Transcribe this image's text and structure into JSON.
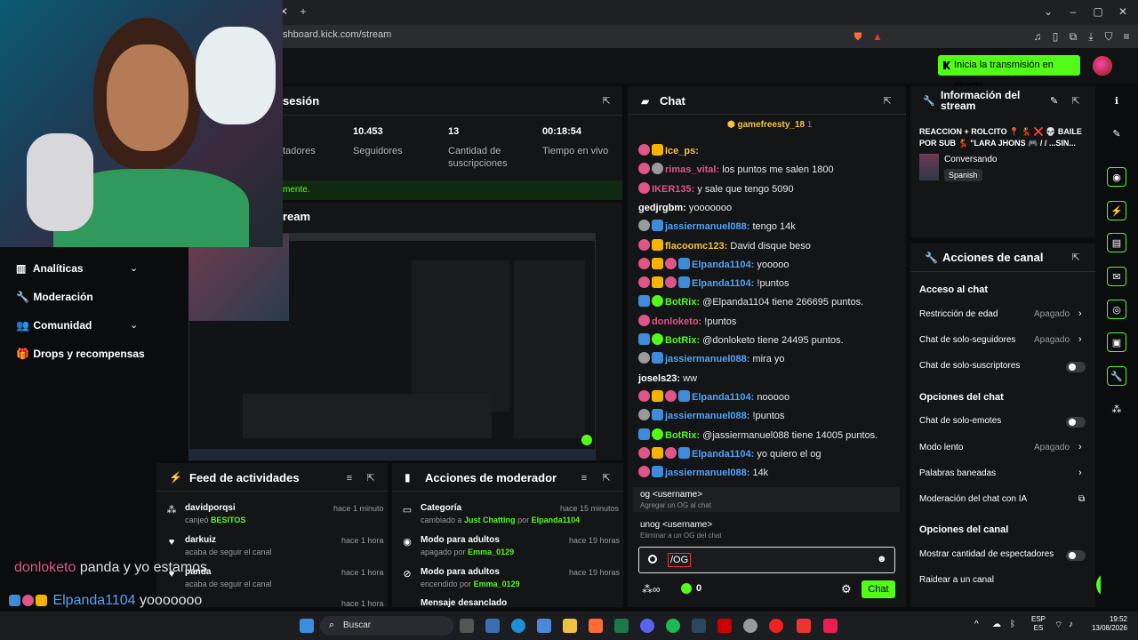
{
  "browser": {
    "url": "shboard.kick.com/stream",
    "new_tab": "+"
  },
  "header": {
    "go_live": "Inicia la transmisión en directo"
  },
  "session": {
    "title_partial": "sesión",
    "stats": [
      {
        "value": "",
        "label": "tadores"
      },
      {
        "value": "10.453",
        "label": "Seguidores"
      },
      {
        "value": "13",
        "label": "Cantidad de suscripciones"
      },
      {
        "value": "00:18:54",
        "label": "Tiempo en vivo"
      }
    ],
    "note_partial": "mente."
  },
  "stream_section_partial": "ream",
  "sidebar": {
    "items": [
      {
        "label": "Analíticas",
        "has_chevron": true
      },
      {
        "label": "Moderación",
        "has_chevron": false
      },
      {
        "label": "Comunidad",
        "has_chevron": true
      },
      {
        "label": "Drops y recompensas",
        "has_chevron": false
      }
    ]
  },
  "chat": {
    "title": "Chat",
    "pinned_user": "gamefreesty_18",
    "pinned_count": "1",
    "messages": [
      {
        "user": "Ice_ps:",
        "text": "",
        "color": "#f5c242"
      },
      {
        "user": "rimas_vital:",
        "text": "los puntos me salen 1800",
        "color": "#e05587"
      },
      {
        "user": "IKER135:",
        "text": "y sale que tengo 5090",
        "color": "#e05587"
      },
      {
        "user": "gedjrgbm:",
        "text": "yooooooo",
        "color": "#ffffff"
      },
      {
        "user": "jassiermanuel088:",
        "text": "tengo 14k",
        "color": "#4fa3f7"
      },
      {
        "user": "flacoomc123:",
        "text": "David disque beso",
        "color": "#f5c242"
      },
      {
        "user": "Elpanda1104:",
        "text": "yooooo",
        "color": "#4fa3f7"
      },
      {
        "user": "Elpanda1104:",
        "text": "!puntos",
        "color": "#4fa3f7"
      },
      {
        "user": "BotRix:",
        "text": "@Elpanda1104 tiene 266695 puntos.",
        "color": "#53fc18"
      },
      {
        "user": "donloketo:",
        "text": "!puntos",
        "color": "#e05587"
      },
      {
        "user": "BotRix:",
        "text": "@donloketo tiene 24495 puntos.",
        "color": "#53fc18"
      },
      {
        "user": "jassiermanuel088:",
        "text": "mira yo",
        "color": "#4fa3f7"
      },
      {
        "user": "josels23:",
        "text": "ww",
        "color": "#ffffff"
      },
      {
        "user": "Elpanda1104:",
        "text": "nooooo",
        "color": "#4fa3f7"
      },
      {
        "user": "jassiermanuel088:",
        "text": "!puntos",
        "color": "#4fa3f7"
      },
      {
        "user": "BotRix:",
        "text": "@jassiermanuel088 tiene 14005 puntos.",
        "color": "#53fc18"
      },
      {
        "user": "Elpanda1104:",
        "text": "yo quiero el og",
        "color": "#4fa3f7"
      },
      {
        "user": "jassiermanuel088:",
        "text": "14k",
        "color": "#4fa3f7"
      }
    ],
    "commands": [
      {
        "cmd": "og <username>",
        "desc": "Agregar un OG al chat"
      },
      {
        "cmd": "unog <username>",
        "desc": "Eliminar a un OG del chat"
      }
    ],
    "input_value": "/OG",
    "viewers": "0",
    "send_label": "Chat"
  },
  "stream_info": {
    "title": "Información del stream",
    "stream_title": "REACCION + ROLCITO 📍 💃 ❌ 💀 BAILE POR SUB 💃 \"LARA JHONS 🎮 / / ...SIN...",
    "category": "Conversando",
    "language": "Spanish"
  },
  "channel_actions": {
    "title": "Acciones de canal",
    "section_chat": "Acceso al chat",
    "rows_access": [
      {
        "label": "Restricción de edad",
        "value": "Apagado",
        "control": "chevron"
      },
      {
        "label": "Chat de solo-seguidores",
        "value": "Apagado",
        "control": "chevron"
      },
      {
        "label": "Chat de solo-suscriptores",
        "value": "",
        "control": "toggle"
      }
    ],
    "section_options": "Opciones del chat",
    "rows_options": [
      {
        "label": "Chat de solo-emotes",
        "value": "",
        "control": "toggle"
      },
      {
        "label": "Modo lento",
        "value": "Apagado",
        "control": "chevron"
      },
      {
        "label": "Palabras baneadas",
        "value": "",
        "control": "chevron"
      },
      {
        "label": "Moderación del chat con IA",
        "value": "",
        "control": "external"
      }
    ],
    "section_channel": "Opciones del canal",
    "rows_channel": [
      {
        "label": "Mostrar cantidad de espectadores",
        "value": "",
        "control": "toggle"
      },
      {
        "label": "Raidear a un canal",
        "value": "",
        "control": "none"
      }
    ]
  },
  "activity_feed": {
    "title": "Feed de actividades",
    "items": [
      {
        "name": "davidporqsi",
        "action": "canjeó",
        "extra": "BESITOS",
        "time": "hace 1 minuto"
      },
      {
        "name": "darkuiz",
        "action": "acaba de seguir el canal",
        "extra": "",
        "time": "hace 1 hora"
      },
      {
        "name": "panda",
        "action": "acaba de seguir el canal",
        "extra": "",
        "time": "hace 1 hora"
      },
      {
        "name": "",
        "action": "",
        "extra": "",
        "time": "hace 1 hora"
      }
    ]
  },
  "mod_actions": {
    "title": "Acciones de moderador",
    "items": [
      {
        "name": "Categoría",
        "desc_pre": "cambiado a",
        "desc_hl": "Just Chatting",
        "desc_mid": "por",
        "desc_user": "Elpanda1104",
        "time": "hace 15 minutos"
      },
      {
        "name": "Modo para adultos",
        "desc_pre": "apagado por",
        "desc_hl": "",
        "desc_mid": "",
        "desc_user": "Emma_0129",
        "time": "hace 19 horas"
      },
      {
        "name": "Modo para adultos",
        "desc_pre": "encendido por",
        "desc_hl": "",
        "desc_mid": "",
        "desc_user": "Emma_0129",
        "time": "hace 19 horas"
      },
      {
        "name": "Mensaje desanclado",
        "desc_pre": "",
        "desc_hl": "",
        "desc_mid": "",
        "desc_user": "",
        "time": ""
      }
    ]
  },
  "overlay": {
    "line1_user": "donloketo",
    "line1_text": "panda y yo estamos",
    "line2_user": "Elpanda1104",
    "line2_text": "yooooooo"
  },
  "taskbar": {
    "search": "Buscar",
    "lang1": "ESP",
    "lang2": "ES",
    "time": "19:52",
    "date": "13/08/2026"
  },
  "colors": {
    "kick_green": "#53fc18",
    "panel": "#141517",
    "background": "#0b0c0e"
  }
}
